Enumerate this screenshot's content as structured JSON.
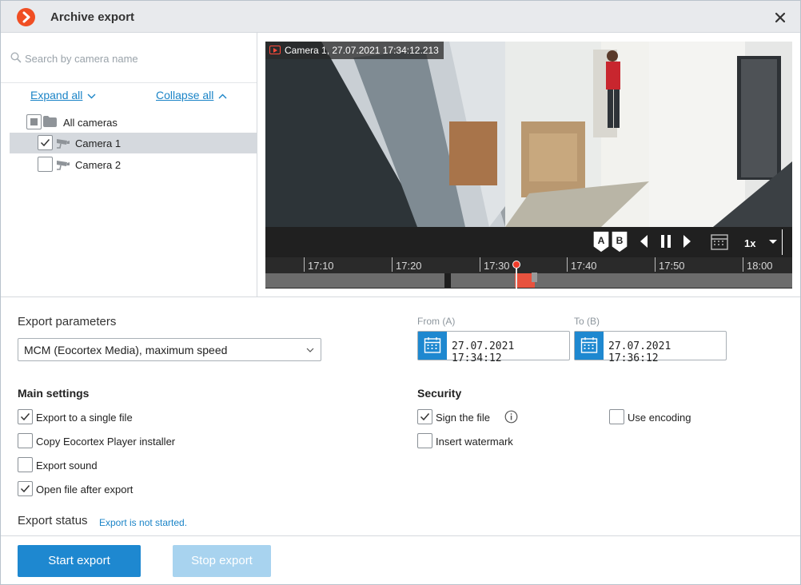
{
  "window": {
    "title": "Archive export",
    "accent": "#1e88d0",
    "logo_color": "#f04e23"
  },
  "search": {
    "placeholder": "Search by camera name",
    "value": ""
  },
  "tree": {
    "expand_all": "Expand all",
    "collapse_all": "Collapse all",
    "root": {
      "label": "All cameras",
      "state": "partial"
    },
    "cameras": [
      {
        "label": "Camera 1",
        "checked": true,
        "selected": true
      },
      {
        "label": "Camera 2",
        "checked": false,
        "selected": false
      }
    ]
  },
  "video": {
    "label": "Camera 1, 27.07.2021 17:34:12.213",
    "speed": "1x",
    "timeline_ticks": [
      "17:10",
      "17:20",
      "17:30",
      "17:40",
      "17:50",
      "18:00"
    ],
    "marker_a": "A",
    "marker_b": "B"
  },
  "export_params": {
    "title": "Export parameters",
    "format": "MCM (Eocortex Media), maximum speed",
    "from_label": "From (A)",
    "to_label": "To (B)",
    "from_value": "27.07.2021  17:34:12",
    "to_value": "27.07.2021  17:36:12"
  },
  "main_settings": {
    "title": "Main settings",
    "options": [
      {
        "label": "Export to a single file",
        "checked": true
      },
      {
        "label": "Copy Eocortex Player installer",
        "checked": false
      },
      {
        "label": "Export sound",
        "checked": false
      },
      {
        "label": "Open file after export",
        "checked": true
      }
    ]
  },
  "security": {
    "title": "Security",
    "sign_file": {
      "label": "Sign the file",
      "checked": true
    },
    "insert_watermark": {
      "label": "Insert watermark",
      "checked": false
    },
    "use_encoding": {
      "label": "Use encoding",
      "checked": false
    }
  },
  "status": {
    "title": "Export status",
    "text": "Export is not started."
  },
  "buttons": {
    "start": "Start export",
    "stop": "Stop export",
    "start_color": "#1e88d0",
    "stop_color": "#a8d3ef"
  }
}
